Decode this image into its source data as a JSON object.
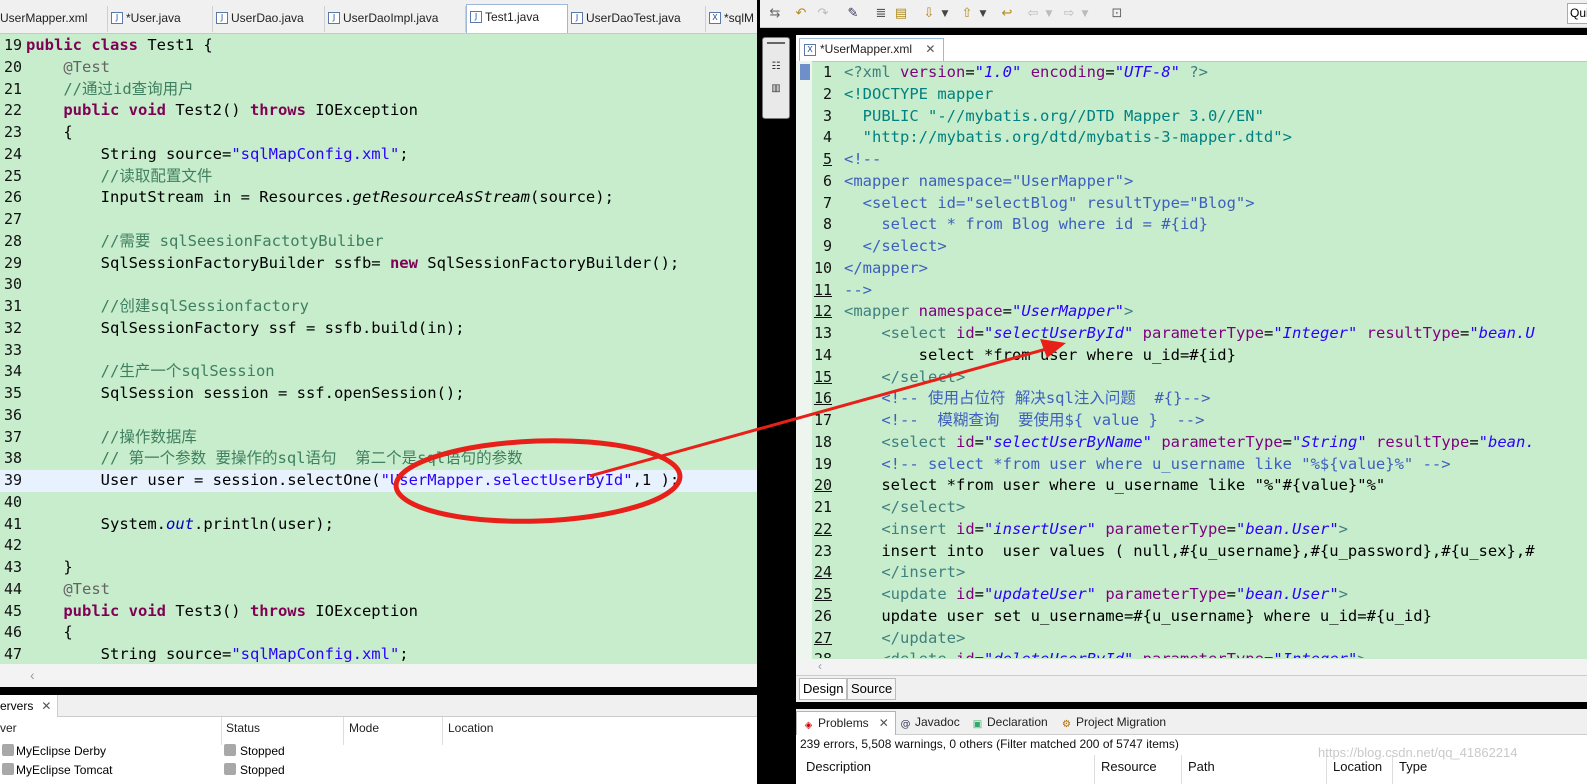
{
  "left_tabs": [
    {
      "label": "UserMapper.xml",
      "icon": "xml-file-icon"
    },
    {
      "label": "*User.java",
      "icon": "java-file-icon"
    },
    {
      "label": "UserDao.java",
      "icon": "java-file-icon"
    },
    {
      "label": "UserDaoImpl.java",
      "icon": "java-file-icon"
    },
    {
      "label": "Test1.java",
      "icon": "java-file-icon",
      "active": true
    },
    {
      "label": "UserDaoTest.java",
      "icon": "java-file-icon"
    },
    {
      "label": "*sqlM",
      "icon": "xml-file-icon"
    }
  ],
  "left_editor": {
    "lines": [
      {
        "n": "19",
        "tokens": [
          [
            "kw",
            "public class "
          ],
          [
            "txt",
            "Test1 {"
          ]
        ]
      },
      {
        "n": "20",
        "tokens": [
          [
            "txt",
            "    "
          ],
          [
            "ann",
            "@Test"
          ]
        ]
      },
      {
        "n": "21",
        "tokens": [
          [
            "txt",
            "    "
          ],
          [
            "cm",
            "//通过id查询用户"
          ]
        ]
      },
      {
        "n": "22",
        "tokens": [
          [
            "txt",
            "    "
          ],
          [
            "kw",
            "public void "
          ],
          [
            "txt",
            "Test2() "
          ],
          [
            "kw",
            "throws "
          ],
          [
            "txt",
            "IOException"
          ]
        ]
      },
      {
        "n": "23",
        "tokens": [
          [
            "txt",
            "    {"
          ]
        ]
      },
      {
        "n": "24",
        "tokens": [
          [
            "txt",
            "        String source="
          ],
          [
            "str",
            "\"sqlMapConfig.xml\""
          ],
          [
            "txt",
            ";"
          ]
        ]
      },
      {
        "n": "25",
        "tokens": [
          [
            "txt",
            "        "
          ],
          [
            "cm",
            "//读取配置文件"
          ]
        ]
      },
      {
        "n": "26",
        "tokens": [
          [
            "txt",
            "        InputStream in = Resources."
          ],
          [
            "ital",
            "getResourceAsStream"
          ],
          [
            "txt",
            "(source);"
          ]
        ]
      },
      {
        "n": "27",
        "tokens": []
      },
      {
        "n": "28",
        "tokens": [
          [
            "txt",
            "        "
          ],
          [
            "cm",
            "//需要 sqlSeesionFactotyBuliber"
          ]
        ]
      },
      {
        "n": "29",
        "tokens": [
          [
            "txt",
            "        SqlSessionFactoryBuilder ssfb= "
          ],
          [
            "kw",
            "new "
          ],
          [
            "txt",
            "SqlSessionFactoryBuilder();"
          ]
        ]
      },
      {
        "n": "30",
        "tokens": []
      },
      {
        "n": "31",
        "tokens": [
          [
            "txt",
            "        "
          ],
          [
            "cm",
            "//创建sqlSessionfactory"
          ]
        ]
      },
      {
        "n": "32",
        "tokens": [
          [
            "txt",
            "        SqlSessionFactory ssf = ssfb.build(in);"
          ]
        ]
      },
      {
        "n": "33",
        "tokens": []
      },
      {
        "n": "34",
        "tokens": [
          [
            "txt",
            "        "
          ],
          [
            "cm",
            "//生产一个sqlSession"
          ]
        ]
      },
      {
        "n": "35",
        "tokens": [
          [
            "txt",
            "        SqlSession session = ssf.openSession();"
          ]
        ]
      },
      {
        "n": "36",
        "tokens": []
      },
      {
        "n": "37",
        "tokens": [
          [
            "txt",
            "        "
          ],
          [
            "cm",
            "//操作数据库"
          ]
        ]
      },
      {
        "n": "38",
        "tokens": [
          [
            "txt",
            "        "
          ],
          [
            "cm",
            "// 第一个参数 要操作的sql语句  第二个是sql语句的参数"
          ]
        ]
      },
      {
        "n": "39",
        "tokens": [
          [
            "txt",
            "        User user = session.selectOne("
          ],
          [
            "str",
            "\"UserMapper.selectUserById\""
          ],
          [
            "txt",
            ",1 );"
          ]
        ],
        "highlight": true
      },
      {
        "n": "40",
        "tokens": []
      },
      {
        "n": "41",
        "tokens": [
          [
            "txt",
            "        System."
          ],
          [
            "fld",
            "out"
          ],
          [
            "txt",
            ".println(user);"
          ]
        ]
      },
      {
        "n": "42",
        "tokens": []
      },
      {
        "n": "43",
        "tokens": [
          [
            "txt",
            "    }"
          ]
        ]
      },
      {
        "n": "44",
        "tokens": [
          [
            "txt",
            "    "
          ],
          [
            "ann",
            "@Test"
          ]
        ]
      },
      {
        "n": "45",
        "tokens": [
          [
            "txt",
            "    "
          ],
          [
            "kw",
            "public void "
          ],
          [
            "txt",
            "Test3() "
          ],
          [
            "kw",
            "throws "
          ],
          [
            "txt",
            "IOException"
          ]
        ]
      },
      {
        "n": "46",
        "tokens": [
          [
            "txt",
            "    {"
          ]
        ]
      },
      {
        "n": "47",
        "tokens": [
          [
            "txt",
            "        String source="
          ],
          [
            "str",
            "\"sqlMapConfig.xml\""
          ],
          [
            "txt",
            ";"
          ]
        ]
      }
    ]
  },
  "servers_panel": {
    "tab_label": "ervers",
    "columns": [
      "ver",
      "Status",
      "Mode",
      "Location"
    ],
    "rows": [
      {
        "name": "MyEclipse Derby",
        "status": "Stopped"
      },
      {
        "name": "MyEclipse Tomcat",
        "status": "Stopped"
      }
    ]
  },
  "right_toolbar": {
    "quick_access": "Qui"
  },
  "right_editor": {
    "tab_label": "*UserMapper.xml",
    "lines": [
      {
        "n": "1",
        "tokens": [
          [
            "pi",
            "<?xml "
          ],
          [
            "attr",
            "version"
          ],
          [
            "txt",
            "="
          ],
          [
            "aval",
            "\"1.0\""
          ],
          [
            "txt",
            " "
          ],
          [
            "attr",
            "encoding"
          ],
          [
            "txt",
            "="
          ],
          [
            "aval",
            "\"UTF-8\""
          ],
          [
            "pi",
            " ?>"
          ]
        ]
      },
      {
        "n": "2",
        "tokens": [
          [
            "dtd",
            "<!DOCTYPE mapper"
          ]
        ]
      },
      {
        "n": "3",
        "tokens": [
          [
            "dtd",
            "  PUBLIC "
          ],
          [
            "dtd",
            "\"-//mybatis.org//DTD Mapper 3.0//EN\""
          ]
        ]
      },
      {
        "n": "4",
        "tokens": [
          [
            "dtd",
            "  \"http://mybatis.org/dtd/mybatis-3-mapper.dtd\">"
          ]
        ]
      },
      {
        "n": "5",
        "ul": true,
        "tokens": [
          [
            "xcm",
            "<!--"
          ]
        ]
      },
      {
        "n": "6",
        "tokens": [
          [
            "xcm",
            "<mapper namespace=\"UserMapper\">"
          ]
        ]
      },
      {
        "n": "7",
        "tokens": [
          [
            "xcm",
            "  <select id=\"selectBlog\" resultType=\"Blog\">"
          ]
        ]
      },
      {
        "n": "8",
        "tokens": [
          [
            "xcm",
            "    select * from Blog where id = #{id}"
          ]
        ]
      },
      {
        "n": "9",
        "tokens": [
          [
            "xcm",
            "  </select>"
          ]
        ]
      },
      {
        "n": "10",
        "tokens": [
          [
            "xcm",
            "</mapper>"
          ]
        ]
      },
      {
        "n": "11",
        "ul": true,
        "tokens": [
          [
            "xcm",
            "-->"
          ]
        ]
      },
      {
        "n": "12",
        "ul": true,
        "tokens": [
          [
            "tag",
            "<mapper "
          ],
          [
            "attr",
            "namespace"
          ],
          [
            "txt",
            "="
          ],
          [
            "aval",
            "\"UserMapper\""
          ],
          [
            "tag",
            ">"
          ]
        ]
      },
      {
        "n": "13",
        "tokens": [
          [
            "txt",
            "    "
          ],
          [
            "tag",
            "<select "
          ],
          [
            "attr",
            "id"
          ],
          [
            "txt",
            "="
          ],
          [
            "aval",
            "\"selectUserById\""
          ],
          [
            "txt",
            " "
          ],
          [
            "attr",
            "parameterType"
          ],
          [
            "txt",
            "="
          ],
          [
            "aval",
            "\"Integer\""
          ],
          [
            "txt",
            " "
          ],
          [
            "attr",
            "resultType"
          ],
          [
            "txt",
            "="
          ],
          [
            "aval",
            "\"bean.U"
          ]
        ]
      },
      {
        "n": "14",
        "tokens": [
          [
            "txt",
            "        select *from user where u_id=#{id}"
          ]
        ]
      },
      {
        "n": "15",
        "ul": true,
        "tokens": [
          [
            "txt",
            "    "
          ],
          [
            "tag",
            "</select>"
          ]
        ]
      },
      {
        "n": "16",
        "ul": true,
        "tokens": [
          [
            "txt",
            "    "
          ],
          [
            "xcm",
            "<!-- 使用占位符 解决sql注入问题  #{}-->"
          ]
        ]
      },
      {
        "n": "17",
        "tokens": [
          [
            "txt",
            "    "
          ],
          [
            "xcm",
            "<!--  模糊查询  要使用${ value }  -->"
          ]
        ]
      },
      {
        "n": "18",
        "tokens": [
          [
            "txt",
            "    "
          ],
          [
            "tag",
            "<select "
          ],
          [
            "attr",
            "id"
          ],
          [
            "txt",
            "="
          ],
          [
            "aval",
            "\"selectUserByName\""
          ],
          [
            "txt",
            " "
          ],
          [
            "attr",
            "parameterType"
          ],
          [
            "txt",
            "="
          ],
          [
            "aval",
            "\"String\""
          ],
          [
            "txt",
            " "
          ],
          [
            "attr",
            "resultType"
          ],
          [
            "txt",
            "="
          ],
          [
            "aval",
            "\"bean."
          ]
        ]
      },
      {
        "n": "19",
        "tokens": [
          [
            "txt",
            "    "
          ],
          [
            "xcm",
            "<!-- select *from user where u_username like \"%${value}%\" -->"
          ]
        ]
      },
      {
        "n": "20",
        "ul": true,
        "tokens": [
          [
            "txt",
            "    select *from user where u_username like \"%\"#{value}\"%\""
          ]
        ]
      },
      {
        "n": "21",
        "tokens": [
          [
            "txt",
            "    "
          ],
          [
            "tag",
            "</select>"
          ]
        ]
      },
      {
        "n": "22",
        "ul": true,
        "tokens": [
          [
            "txt",
            "    "
          ],
          [
            "tag",
            "<insert "
          ],
          [
            "attr",
            "id"
          ],
          [
            "txt",
            "="
          ],
          [
            "aval",
            "\"insertUser\""
          ],
          [
            "txt",
            " "
          ],
          [
            "attr",
            "parameterType"
          ],
          [
            "txt",
            "="
          ],
          [
            "aval",
            "\"bean.User\""
          ],
          [
            "tag",
            ">"
          ]
        ]
      },
      {
        "n": "23",
        "tokens": [
          [
            "txt",
            "    insert into  user values ( null,#{u_username},#{u_password},#{u_sex},#"
          ]
        ]
      },
      {
        "n": "24",
        "ul": true,
        "tokens": [
          [
            "txt",
            "    "
          ],
          [
            "tag",
            "</insert>"
          ]
        ]
      },
      {
        "n": "25",
        "ul": true,
        "tokens": [
          [
            "txt",
            "    "
          ],
          [
            "tag",
            "<update "
          ],
          [
            "attr",
            "id"
          ],
          [
            "txt",
            "="
          ],
          [
            "aval",
            "\"updateUser\""
          ],
          [
            "txt",
            " "
          ],
          [
            "attr",
            "parameterType"
          ],
          [
            "txt",
            "="
          ],
          [
            "aval",
            "\"bean.User\""
          ],
          [
            "tag",
            ">"
          ]
        ]
      },
      {
        "n": "26",
        "tokens": [
          [
            "txt",
            "    update user set u_username=#{u_username} where u_id=#{u_id}"
          ]
        ]
      },
      {
        "n": "27",
        "ul": true,
        "tokens": [
          [
            "txt",
            "    "
          ],
          [
            "tag",
            "</update>"
          ]
        ]
      },
      {
        "n": "28",
        "tokens": [
          [
            "txt",
            "    "
          ],
          [
            "tag",
            "<delete "
          ],
          [
            "attr",
            "id"
          ],
          [
            "txt",
            "="
          ],
          [
            "aval",
            "\"deleteUserById\""
          ],
          [
            "txt",
            " "
          ],
          [
            "attr",
            "parameterType"
          ],
          [
            "txt",
            "="
          ],
          [
            "aval",
            "\"Integer\""
          ],
          [
            "tag",
            ">"
          ]
        ]
      }
    ]
  },
  "design_tabs": [
    {
      "label": "Design",
      "active": true
    },
    {
      "label": "Source"
    }
  ],
  "problems_panel": {
    "tabs": [
      {
        "label": "Problems",
        "icon": "problems-icon",
        "active": true
      },
      {
        "label": "Javadoc",
        "icon": "javadoc-icon"
      },
      {
        "label": "Declaration",
        "icon": "declaration-icon"
      },
      {
        "label": "Project Migration",
        "icon": "migration-icon"
      }
    ],
    "summary": "239 errors, 5,508 warnings, 0 others (Filter matched 200 of 5747 items)",
    "columns": [
      "Description",
      "Resource",
      "Path",
      "Location",
      "Type"
    ]
  },
  "watermark": "https://blog.csdn.net/qq_41862214",
  "colors": {
    "editor_bg": "#c7edcc",
    "annotation_red": "#e8201a",
    "keyword": "#7f0055",
    "string": "#2a00ff"
  }
}
